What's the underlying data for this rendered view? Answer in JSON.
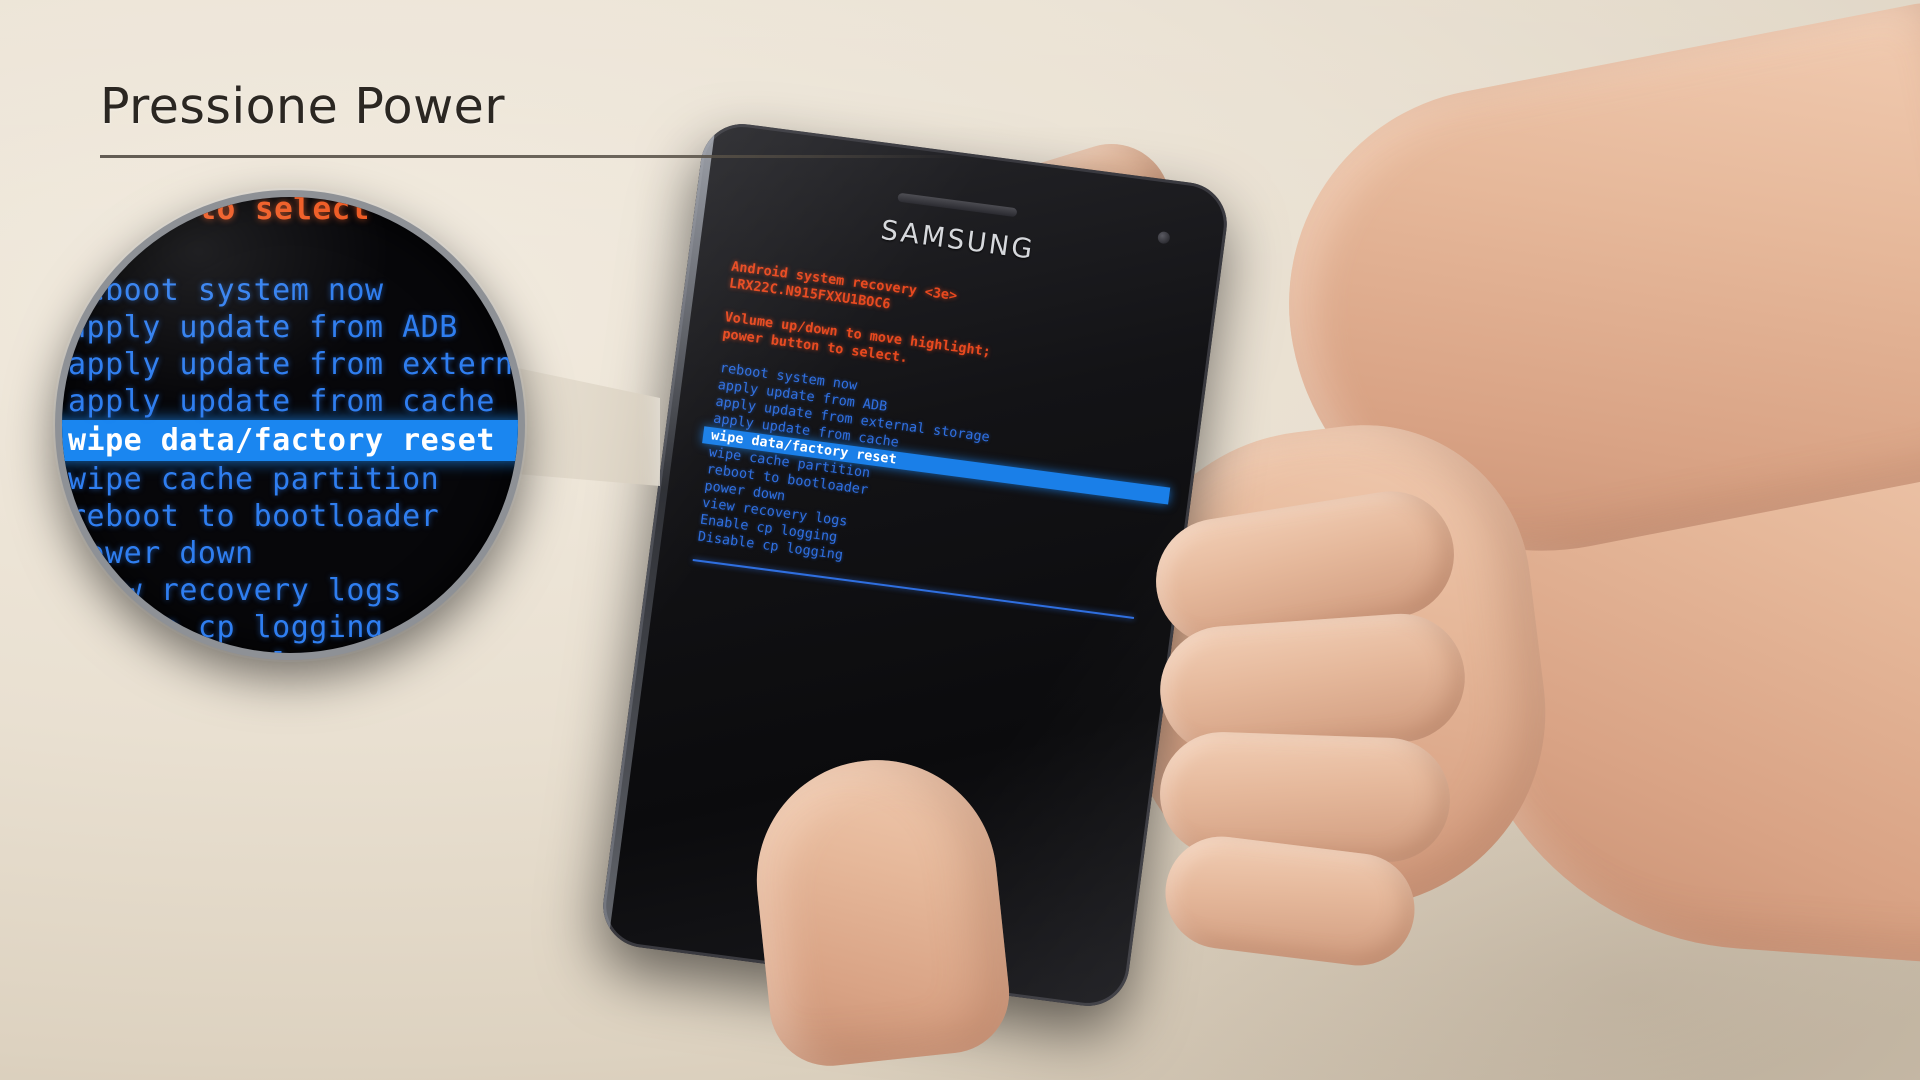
{
  "caption": {
    "title": "Pressione Power"
  },
  "phone": {
    "brand": "SAMSUNG",
    "screen": {
      "header_lines": [
        "Android system recovery <3e>",
        "LRX22C.N915FXXU1BOC6"
      ],
      "instruction_lines": [
        "Volume up/down to move highlight;",
        "power button to select."
      ],
      "menu_items": [
        "reboot system now",
        "apply update from ADB",
        "apply update from external storage",
        "apply update from cache",
        "wipe data/factory reset",
        "wipe cache partition",
        "reboot to bootloader",
        "power down",
        "view recovery logs",
        "Enable cp logging",
        "Disable cp logging"
      ],
      "selected_index": 4,
      "selected_item": "wipe data/factory reset"
    }
  },
  "magnifier": {
    "header_fragment": "on to select",
    "visible_items": [
      "reboot system now",
      "apply update from ADB",
      "apply update from external storage",
      "apply update from cache",
      "wipe data/factory reset",
      "wipe cache partition",
      "reboot to bootloader",
      "power down",
      "view recovery logs",
      "Enable cp logging",
      "Disable cp logging"
    ],
    "selected_item": "wipe data/factory reset"
  },
  "colors": {
    "background": "#ece4d6",
    "caption_text": "#2b2722",
    "menu_blue": "#2f7ef0",
    "highlight_blue": "#1a86f0",
    "highlight_text": "#ffffff",
    "header_orange": "#ef5a22",
    "phone_body": "#131316",
    "magnifier_rim": "#8e9196"
  }
}
